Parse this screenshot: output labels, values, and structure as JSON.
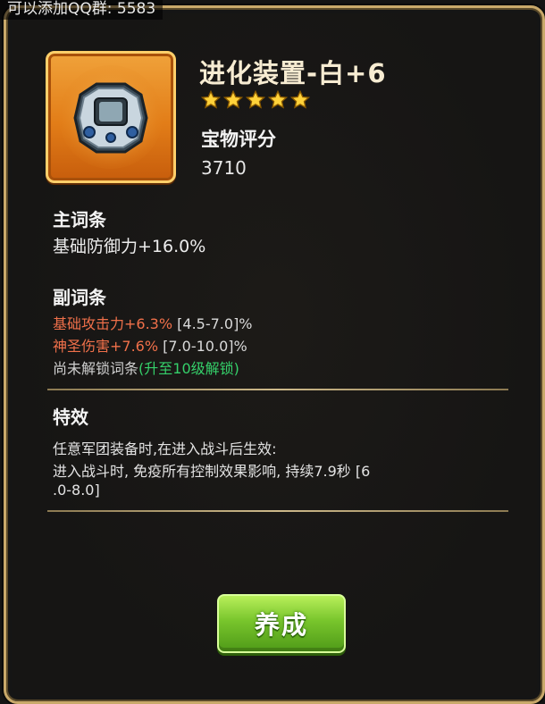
{
  "banner": {
    "text": "可以添加QQ群: 5583"
  },
  "item": {
    "name": "进化装置-白+6",
    "star_count": 5,
    "score_label": "宝物评分",
    "score_value": "3710",
    "icon": "digivice-icon"
  },
  "main_stat": {
    "title": "主词条",
    "value": "基础防御力+16.0%"
  },
  "sub_stats": {
    "title": "副词条",
    "items": [
      {
        "label": "基础攻击力+6.3%",
        "range": "[4.5-7.0]%"
      },
      {
        "label": "神圣伤害+7.6%",
        "range": "[7.0-10.0]%"
      }
    ],
    "locked_text": "尚未解锁词条",
    "unlock_hint": "(升至10级解锁)"
  },
  "effect": {
    "title": "特效",
    "line1": "任意军团装备时,在进入战斗后生效:",
    "line2": "进入战斗时, 免疫所有控制效果影响, 持续7.9秒  [6",
    "line3": ".0-8.0]"
  },
  "actions": {
    "cultivate_label": "养成"
  },
  "colors": {
    "accent_orange": "#f0704a",
    "accent_green": "#35d06a",
    "frame_gold": "#c9a96a",
    "button_green": "#78c52c"
  }
}
